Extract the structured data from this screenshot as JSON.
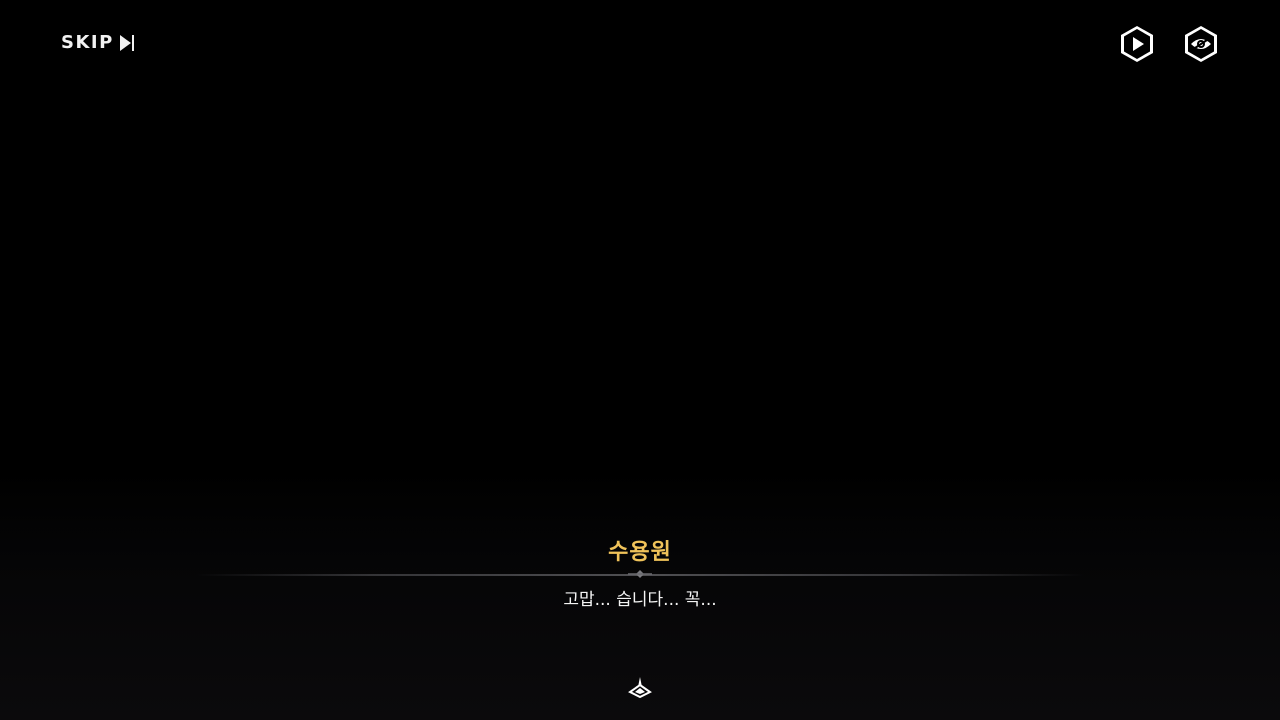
{
  "skip": {
    "label": "SKIP",
    "icon": "skip-forward-icon"
  },
  "top_right_controls": [
    {
      "icon": "auto-play-icon"
    },
    {
      "icon": "hide-ui-eye-icon"
    }
  ],
  "dialogue": {
    "speaker": "수용원",
    "text": "고맙... 습니다... 꼭...",
    "next_icon": "next-arrow-icon"
  },
  "colors": {
    "speaker": "#f0c35a",
    "text": "#f4f4f4",
    "background": "#000000"
  }
}
